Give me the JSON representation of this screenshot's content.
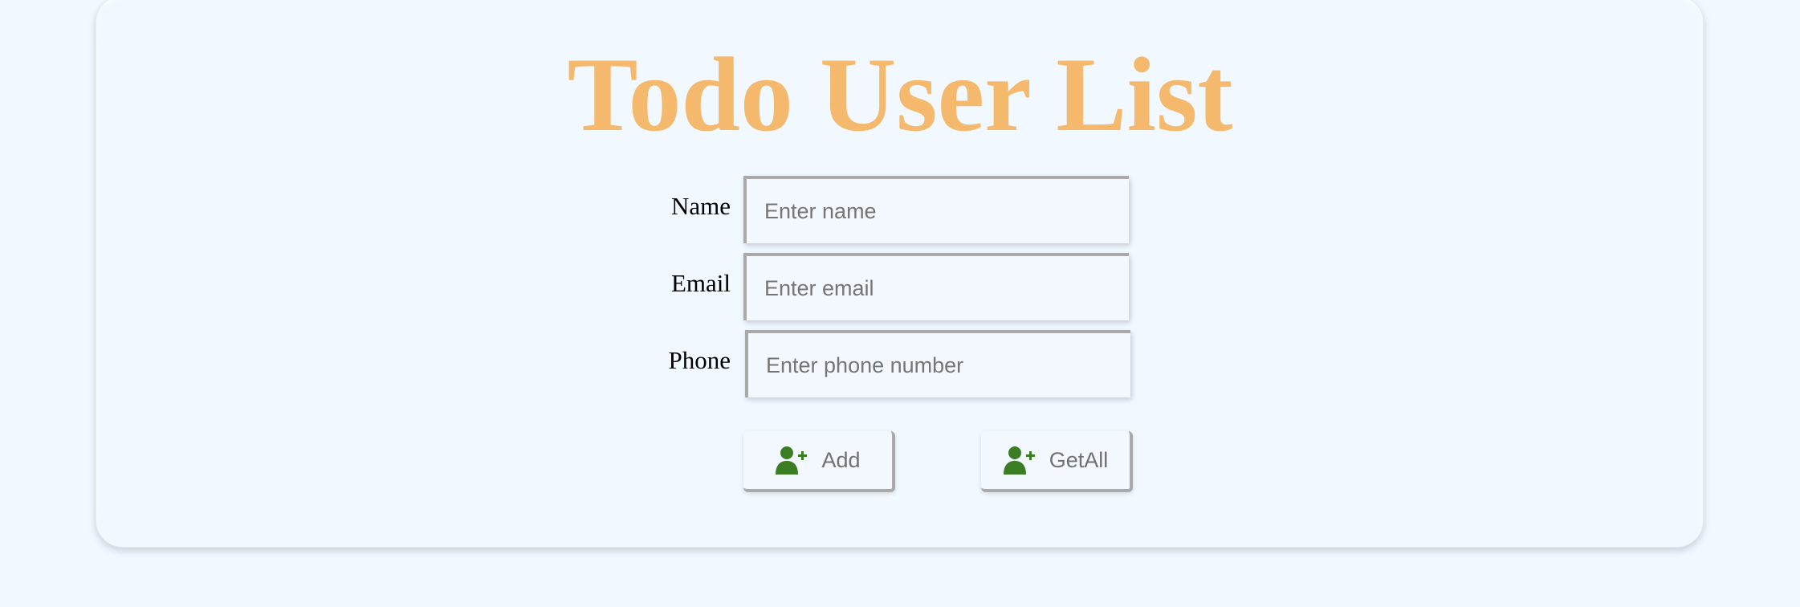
{
  "title": "Todo User List",
  "form": {
    "name_label": "Name",
    "name_placeholder": "Enter name",
    "email_label": "Email",
    "email_placeholder": "Enter email",
    "phone_label": "Phone",
    "phone_placeholder": "Enter phone number"
  },
  "buttons": {
    "add_label": "Add",
    "add_icon": "user-plus-icon",
    "getall_label": "GetAll",
    "getall_icon": "user-plus-icon"
  },
  "colors": {
    "background": "#f1f8ff",
    "title": "#f4b96c",
    "icon": "#3a7d23"
  }
}
